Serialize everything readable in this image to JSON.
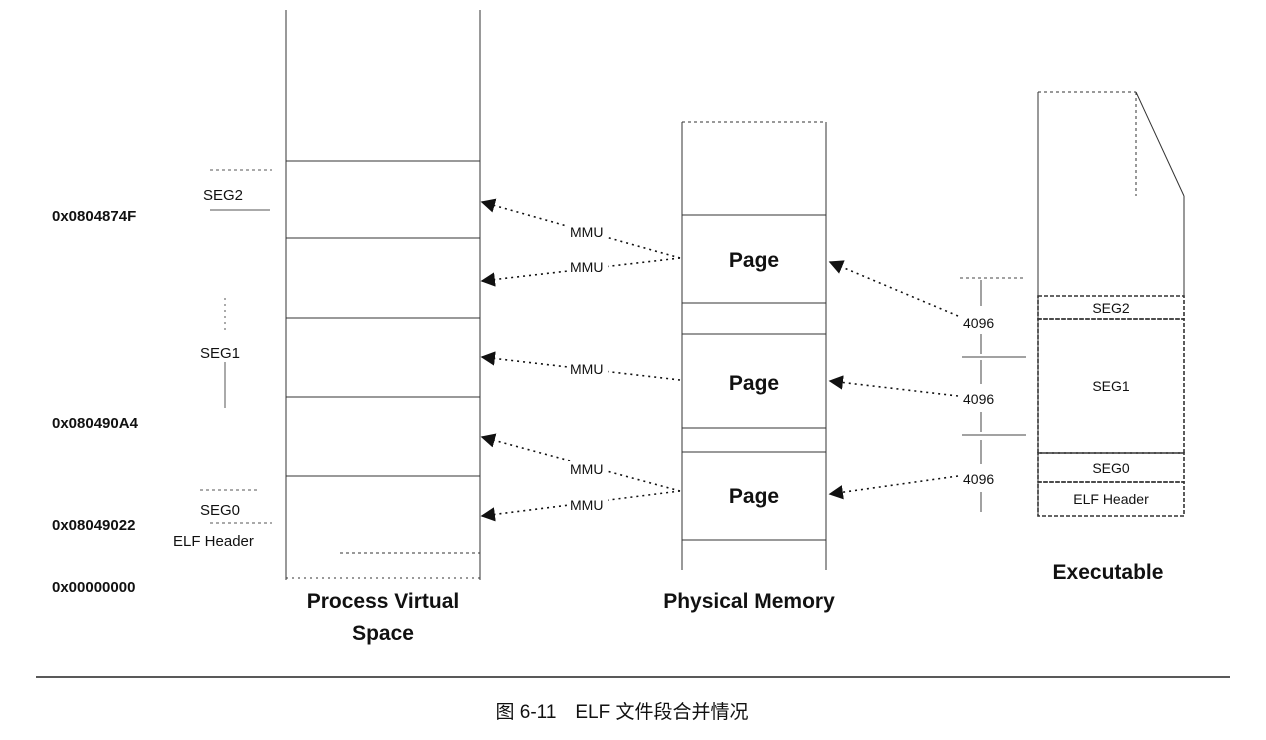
{
  "virtual": {
    "title_line1": "Process Virtual",
    "title_line2": "Space",
    "address_0": "0x0804874F",
    "address_1": "0x080490A4",
    "address_2": "0x08049022",
    "address_3": "0x00000000",
    "seg2": "SEG2",
    "seg1": "SEG1",
    "seg0": "SEG0",
    "elf_header": "ELF Header"
  },
  "physical": {
    "title": "Physical Memory",
    "page_1": "Page",
    "page_2": "Page",
    "page_3": "Page"
  },
  "mmu": {
    "label_1": "MMU",
    "label_2": "MMU",
    "label_3": "MMU",
    "label_4": "MMU",
    "label_5": "MMU"
  },
  "executable": {
    "title": "Executable",
    "size_1": "4096",
    "size_2": "4096",
    "size_3": "4096",
    "seg2": "SEG2",
    "seg1": "SEG1",
    "seg0": "SEG0",
    "elf_header": "ELF Header"
  },
  "caption": "图 6-11　ELF 文件段合并情况"
}
